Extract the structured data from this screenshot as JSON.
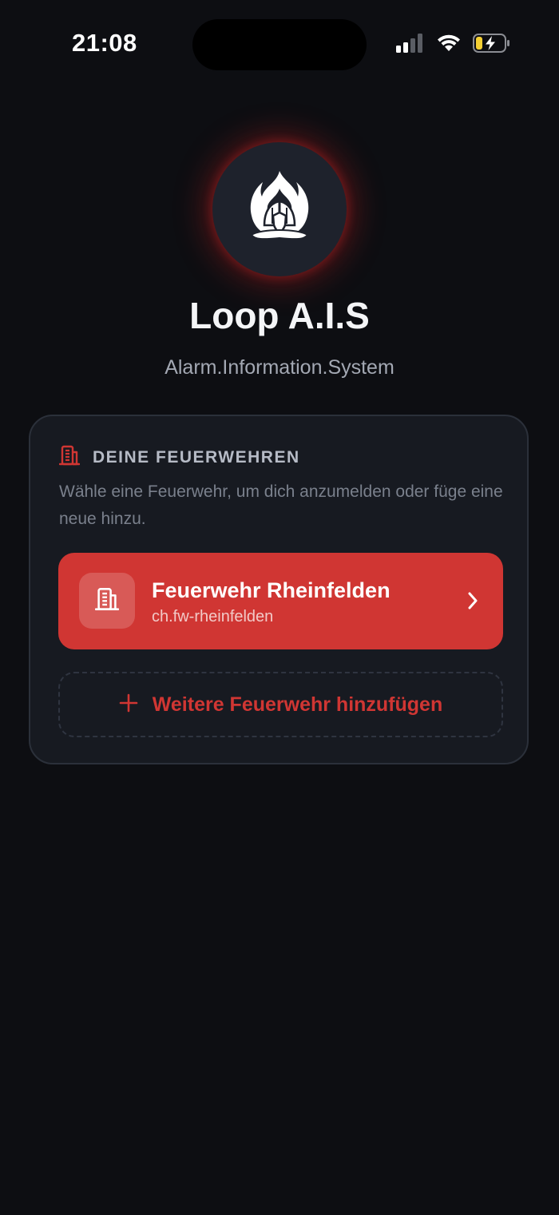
{
  "status_bar": {
    "time": "21:08",
    "icons": [
      "cellular-signal-icon",
      "wifi-icon",
      "battery-charging-icon"
    ]
  },
  "app": {
    "logo_icon": "flame-helmet-logo-icon",
    "title": "Loop A.I.S",
    "subtitle": "Alarm.Information.System"
  },
  "brigades_card": {
    "icon": "building-icon",
    "heading": "DEINE FEUERWEHREN",
    "description": "Wähle eine Feuerwehr, um dich anzumelden oder füge eine neue hinzu.",
    "items": [
      {
        "name": "Feuerwehr Rheinfelden",
        "id": "ch.fw-rheinfelden",
        "icon": "building-icon"
      }
    ],
    "add_button_label": "Weitere Feuerwehr hinzufügen"
  },
  "colors": {
    "background": "#0d0e12",
    "card": "#171a21",
    "accent": "#d03633",
    "text_primary": "#f4f5f7",
    "text_secondary": "#a3a8b3",
    "battery_level": "#f5d033"
  }
}
